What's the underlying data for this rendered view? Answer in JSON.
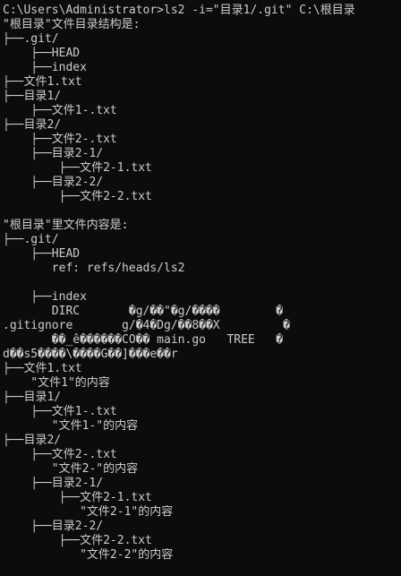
{
  "console": {
    "lines": [
      "C:\\Users\\Administrator>ls2 -i=\"目录1/.git\" C:\\根目录",
      "\"根目录\"文件目录结构是:",
      "├──.git/",
      "    ├──HEAD",
      "    ├──index",
      "├──文件1.txt",
      "├──目录1/",
      "    ├──文件1-.txt",
      "├──目录2/",
      "    ├──文件2-.txt",
      "    ├──目录2-1/",
      "        ├──文件2-1.txt",
      "    ├──目录2-2/",
      "        ├──文件2-2.txt",
      "",
      "\"根目录\"里文件内容是:",
      "├──.git/",
      "    ├──HEAD",
      "       ref: refs/heads/ls2",
      "",
      "    ├──index",
      "       DIRC       �g/��\"�g/����        �",
      ".gitignore       g/�4�Dg/��8��X         �",
      "       ��_ê������CO�� main.go   TREE   �",
      "d��s5����\\����G��]���e��r",
      "├──文件1.txt",
      "    \"文件1\"的内容",
      "├──目录1/",
      "    ├──文件1-.txt",
      "       \"文件1-\"的内容",
      "├──目录2/",
      "    ├──文件2-.txt",
      "       \"文件2-\"的内容",
      "    ├──目录2-1/",
      "        ├──文件2-1.txt",
      "           \"文件2-1\"的内容",
      "    ├──目录2-2/",
      "        ├──文件2-2.txt",
      "           \"文件2-2\"的内容"
    ]
  }
}
